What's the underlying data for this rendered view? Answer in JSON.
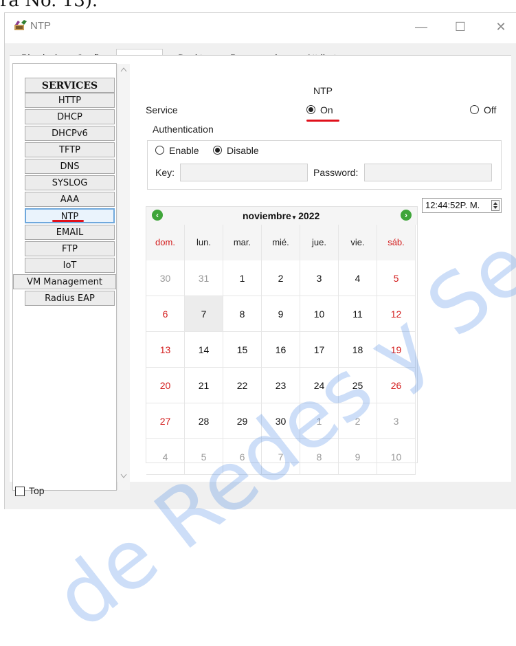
{
  "caption": "ra No. 13).",
  "window": {
    "title": "NTP",
    "controls": {
      "minimize": "—",
      "maximize": "☐",
      "close": "✕"
    }
  },
  "tabs": [
    "Physical",
    "Config",
    "Services",
    "Desktop",
    "Programming",
    "Attributes"
  ],
  "sidebar": {
    "header": "SERVICES",
    "items": [
      "HTTP",
      "DHCP",
      "DHCPv6",
      "TFTP",
      "DNS",
      "SYSLOG",
      "AAA",
      "NTP",
      "EMAIL",
      "FTP",
      "IoT",
      "VM Management",
      "Radius EAP"
    ],
    "selected": "NTP"
  },
  "ntp": {
    "heading": "NTP",
    "service_label": "Service",
    "on_label": "On",
    "off_label": "Off",
    "auth_title": "Authentication",
    "enable_label": "Enable",
    "disable_label": "Disable",
    "key_label": "Key:",
    "password_label": "Password:",
    "key_value": "",
    "password_value": ""
  },
  "calendar": {
    "month": "noviembre",
    "year": "2022",
    "weekdays": [
      "dom.",
      "lun.",
      "mar.",
      "mié.",
      "jue.",
      "vie.",
      "sáb."
    ],
    "weeks": [
      [
        "30",
        "31",
        "1",
        "2",
        "3",
        "4",
        "5"
      ],
      [
        "6",
        "7",
        "8",
        "9",
        "10",
        "11",
        "12"
      ],
      [
        "13",
        "14",
        "15",
        "16",
        "17",
        "18",
        "19"
      ],
      [
        "20",
        "21",
        "22",
        "23",
        "24",
        "25",
        "26"
      ],
      [
        "27",
        "28",
        "29",
        "30",
        "1",
        "2",
        "3"
      ],
      [
        "4",
        "5",
        "6",
        "7",
        "8",
        "9",
        "10"
      ]
    ],
    "selected_day": "7",
    "weekend_color": "#d31b1b",
    "muted_color": "#9a9a9a"
  },
  "time": {
    "value": "12:44:52P. M."
  },
  "footer": {
    "top_label": "Top"
  },
  "watermark": "de Redes y Seguridad",
  "colors": {
    "accent_underline": "#e0101b",
    "selected_border": "#6fa8dc",
    "nav_green": "#3fa53a"
  }
}
